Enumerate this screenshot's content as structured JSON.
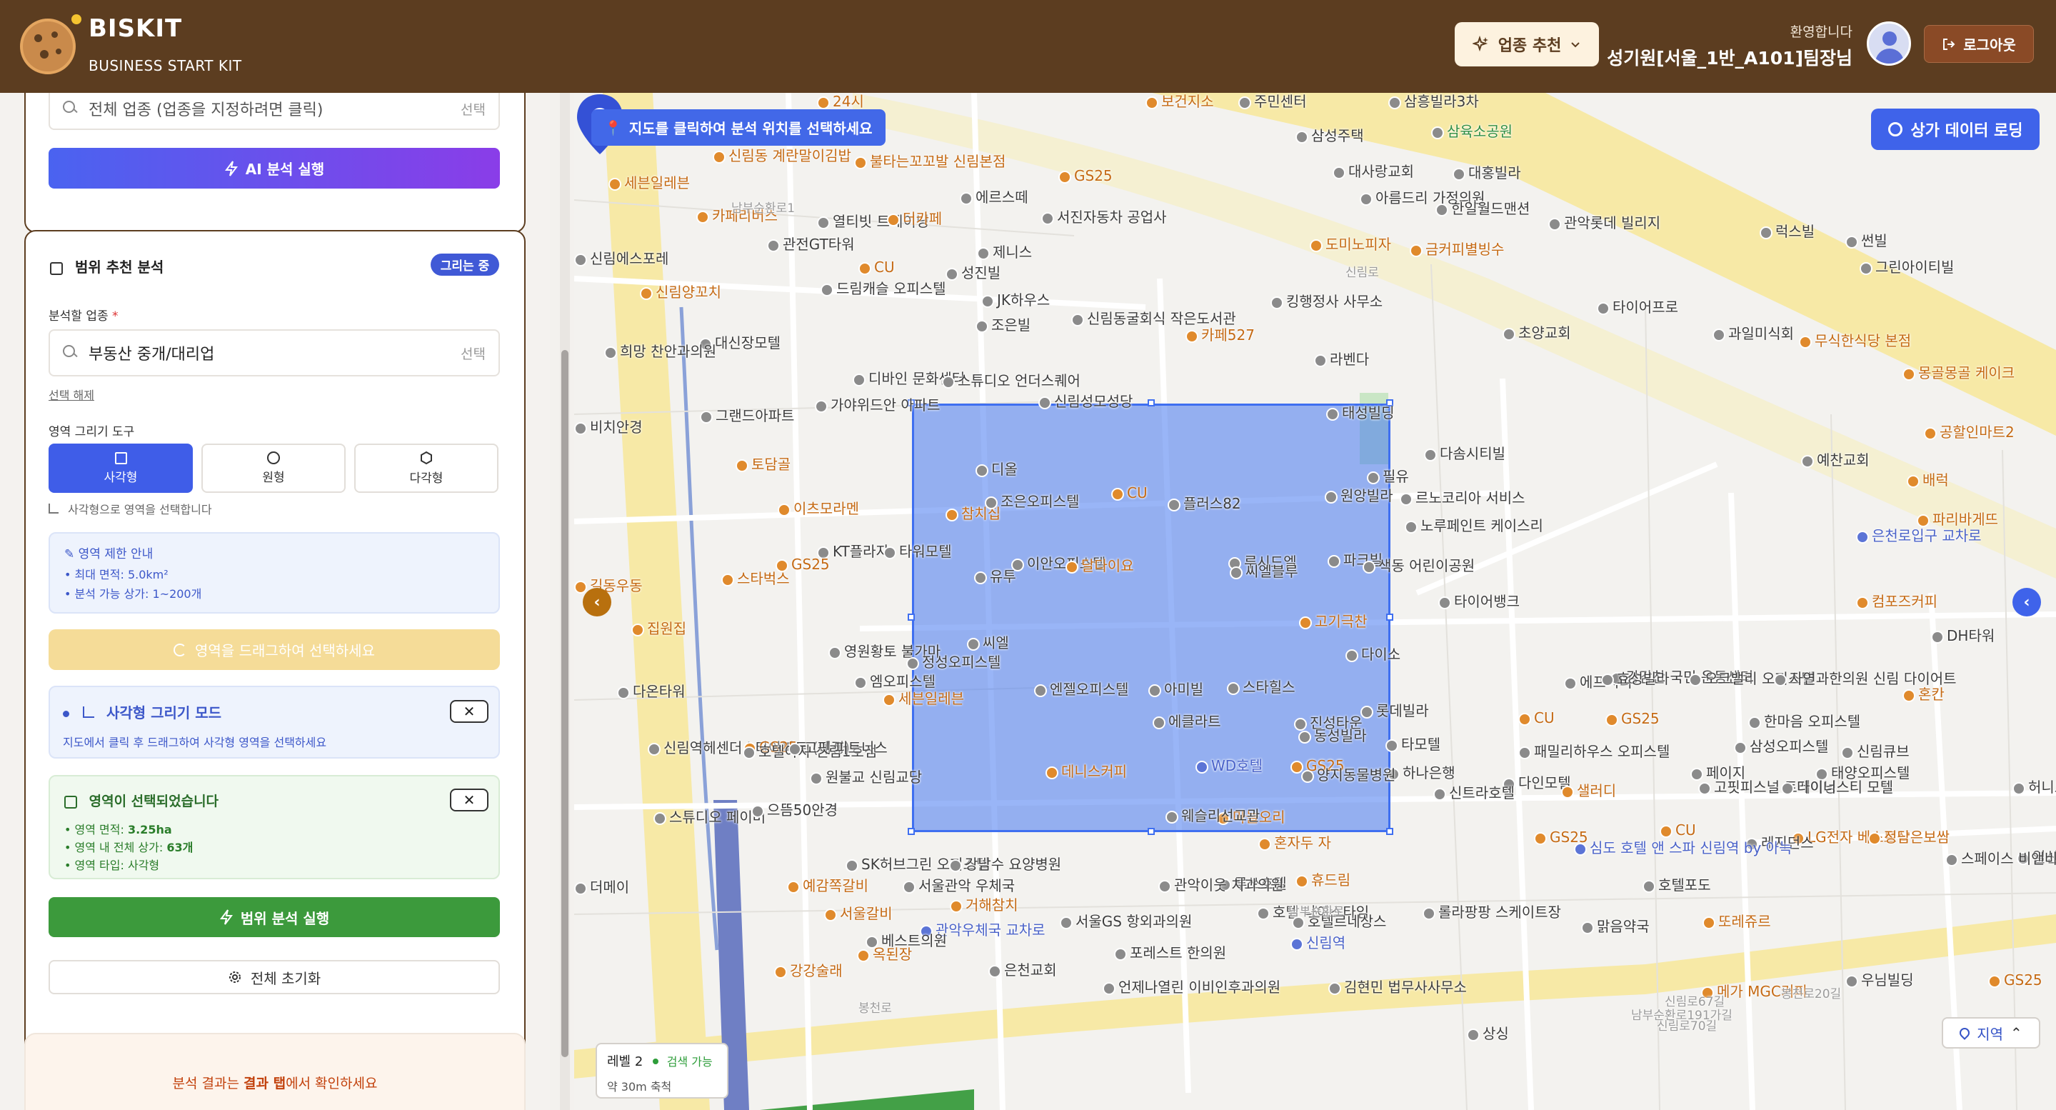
{
  "header": {
    "brand": "BISKIT",
    "subtitle": "BUSINESS START KIT",
    "business_recommend_label": "업종 추천",
    "welcome": "환영합니다",
    "username": "성기원[서울_1반_A101]팀장님",
    "logout_label": "로그아웃"
  },
  "sidebar": {
    "top_card": {
      "search_placeholder": "전체 업종 (업종을 지정하려면 클릭)",
      "select_label": "선택",
      "ai_button": "AI 분석 실행"
    },
    "range_card": {
      "title": "범위 추천 분석",
      "badge": "그리는 중",
      "business_label": "분석할 업종",
      "required_mark": "*",
      "business_value": "부동산 중개/대리업",
      "select_label": "선택",
      "deselect": "선택 해제",
      "draw_tool_label": "영역 그리기 도구",
      "tools": [
        {
          "label": "사각형",
          "icon": "square-icon",
          "active": true
        },
        {
          "label": "원형",
          "icon": "circle-icon",
          "active": false
        },
        {
          "label": "다각형",
          "icon": "hexagon-icon",
          "active": false
        }
      ],
      "tool_hint": "사각형으로 영역을 선택합니다",
      "limit_title": "영역 제한 안내",
      "limit_items": [
        "• 최대 면적: 5.0km²",
        "• 분석 가능 상가: 1~200개"
      ],
      "drag_notice": "영역을 드래그하여 선택하세요",
      "mode_title": "사각형 그리기 모드",
      "mode_desc": "지도에서 클릭 후 드래그하여 사각형 영역을 선택하세요",
      "selected_title": "영역이 선택되었습니다",
      "selected_items": [
        {
          "label": "• 영역 면적: ",
          "value": "3.25ha"
        },
        {
          "label": "• 영역 내 전체 상가: ",
          "value": "63개"
        },
        {
          "label": "• 영역 타입: ",
          "value": "사각형"
        }
      ],
      "range_button": "범위 분석 실행",
      "reset_button": "전체 초기화"
    },
    "result_note": {
      "prefix": "분석 결과는 ",
      "bold": "결과 탭",
      "suffix": "에서 확인하세요"
    }
  },
  "map": {
    "hint": "지도를 클릭하여 분석 위치를 선택하세요",
    "store_button": "상가 데이터 로딩",
    "level_title": "레벨 2",
    "level_status": "검색 가능",
    "level_scale": "약 30m 축척",
    "region_button": "지역",
    "colors": {
      "selection": "#4678f0",
      "road_main": "#f7e9a6",
      "park": "#c9e6c5"
    },
    "labels": [
      {
        "text": "24시",
        "c": "orange"
      },
      {
        "text": "보건지소",
        "c": "orange"
      },
      {
        "text": "주민센터",
        "c": ""
      },
      {
        "text": "삼흥빌라3차",
        "c": ""
      },
      {
        "text": "삼육소공원",
        "c": "green"
      },
      {
        "text": "신림동 계란말이김밥",
        "c": "orange"
      },
      {
        "text": "불타는꼬꼬발 신림본점",
        "c": "orange"
      },
      {
        "text": "세븐일레븐",
        "c": "orange"
      },
      {
        "text": "에르스떼",
        "c": ""
      },
      {
        "text": "GS25",
        "c": "orange"
      },
      {
        "text": "대사랑교회",
        "c": ""
      },
      {
        "text": "삼성주택",
        "c": ""
      },
      {
        "text": "대홍빌라",
        "c": ""
      },
      {
        "text": "카페리버스",
        "c": "orange"
      },
      {
        "text": "열티빗 트레이닝",
        "c": ""
      },
      {
        "text": "더카페",
        "c": "orange"
      },
      {
        "text": "아름드리 가정의원",
        "c": ""
      },
      {
        "text": "한일월드맨션",
        "c": ""
      },
      {
        "text": "관악롯데 빌리지",
        "c": ""
      },
      {
        "text": "럭스빌",
        "c": ""
      },
      {
        "text": "썬빌",
        "c": ""
      },
      {
        "text": "관전GT타워",
        "c": ""
      },
      {
        "text": "CU",
        "c": "orange"
      },
      {
        "text": "제니스",
        "c": ""
      },
      {
        "text": "서진자동차 공업사",
        "c": ""
      },
      {
        "text": "도미노피자",
        "c": "orange"
      },
      {
        "text": "금커피별빙수",
        "c": "orange"
      },
      {
        "text": "그린아이티빌",
        "c": ""
      },
      {
        "text": "신림에스포레",
        "c": ""
      },
      {
        "text": "성진빌",
        "c": ""
      },
      {
        "text": "드림캐슬 오피스텔",
        "c": ""
      },
      {
        "text": "JK하우스",
        "c": ""
      },
      {
        "text": "신림양꼬치",
        "c": "orange"
      },
      {
        "text": "조은빌",
        "c": ""
      },
      {
        "text": "신림동굴회식 작은도서관",
        "c": ""
      },
      {
        "text": "킹행정사 사무소",
        "c": ""
      },
      {
        "text": "카페527",
        "c": "orange"
      },
      {
        "text": "타이어프로",
        "c": ""
      },
      {
        "text": "대신장모텔",
        "c": ""
      },
      {
        "text": "희망 찬안과의원",
        "c": ""
      },
      {
        "text": "라벤다",
        "c": ""
      },
      {
        "text": "초양교회",
        "c": ""
      },
      {
        "text": "과일미식회",
        "c": ""
      },
      {
        "text": "무식한식당 본점",
        "c": "orange"
      },
      {
        "text": "디바인 문화센터",
        "c": ""
      },
      {
        "text": "스튜디오 언더스퀘어",
        "c": ""
      },
      {
        "text": "몽골몽골 케이크",
        "c": "orange"
      },
      {
        "text": "공할인마트2",
        "c": "orange"
      },
      {
        "text": "그랜드아파트",
        "c": ""
      },
      {
        "text": "신림성모성당",
        "c": ""
      },
      {
        "text": "태성빌딩",
        "c": ""
      },
      {
        "text": "가야위드안 아파트",
        "c": ""
      },
      {
        "text": "토담골",
        "c": "orange"
      },
      {
        "text": "비치안경",
        "c": ""
      },
      {
        "text": "다솜시티빌",
        "c": ""
      },
      {
        "text": "필유",
        "c": ""
      },
      {
        "text": "예찬교회",
        "c": ""
      },
      {
        "text": "배럭",
        "c": "orange"
      },
      {
        "text": "이츠모라멘",
        "c": "orange"
      },
      {
        "text": "디올",
        "c": ""
      },
      {
        "text": "참치집",
        "c": "orange"
      },
      {
        "text": "조은오피스텔",
        "c": ""
      },
      {
        "text": "CU",
        "c": "orange"
      },
      {
        "text": "플러스82",
        "c": ""
      },
      {
        "text": "원앙빌라",
        "c": ""
      },
      {
        "text": "르노코리아 서비스",
        "c": ""
      },
      {
        "text": "파리바게뜨",
        "c": "orange"
      },
      {
        "text": "KT플라자",
        "c": ""
      },
      {
        "text": "노루페인트 케이스리",
        "c": ""
      },
      {
        "text": "은천로입구 교차로",
        "c": "blue"
      },
      {
        "text": "GS25",
        "c": "orange"
      },
      {
        "text": "이안오피스텔",
        "c": ""
      },
      {
        "text": "달다이요",
        "c": "orange"
      },
      {
        "text": "루시드엘",
        "c": ""
      },
      {
        "text": "파크빌",
        "c": ""
      },
      {
        "text": "타워모텔",
        "c": ""
      },
      {
        "text": "유투",
        "c": ""
      },
      {
        "text": "씨엘블루",
        "c": ""
      },
      {
        "text": "색동 어린이공원",
        "c": ""
      },
      {
        "text": "타이어뱅크",
        "c": ""
      },
      {
        "text": "컴포즈커피",
        "c": "orange"
      },
      {
        "text": "길동우동",
        "c": "orange"
      },
      {
        "text": "스타벅스",
        "c": "orange"
      },
      {
        "text": "집원집",
        "c": "orange"
      },
      {
        "text": "영원황토 불가마",
        "c": ""
      },
      {
        "text": "씨엘",
        "c": ""
      },
      {
        "text": "고기극찬",
        "c": "orange"
      },
      {
        "text": "DH타워",
        "c": ""
      },
      {
        "text": "정성오피스텔",
        "c": ""
      },
      {
        "text": "다이소",
        "c": ""
      },
      {
        "text": "엠오피스텔",
        "c": ""
      },
      {
        "text": "엔젤오피스텔",
        "c": ""
      },
      {
        "text": "아미빌",
        "c": ""
      },
      {
        "text": "에프씨티",
        "c": ""
      },
      {
        "text": "강감찬 국민 운동센터",
        "c": ""
      },
      {
        "text": "효성빌라",
        "c": ""
      },
      {
        "text": "오크밸리 오피스텔",
        "c": ""
      },
      {
        "text": "자연과한의원 신림 다이어트",
        "c": ""
      },
      {
        "text": "혼칸",
        "c": "orange"
      },
      {
        "text": "다온타워",
        "c": ""
      },
      {
        "text": "세븐일레븐",
        "c": "orange"
      },
      {
        "text": "스타힐스",
        "c": ""
      },
      {
        "text": "진성타운",
        "c": ""
      },
      {
        "text": "롯데빌라",
        "c": ""
      },
      {
        "text": "CU",
        "c": "orange"
      },
      {
        "text": "GS25",
        "c": "orange"
      },
      {
        "text": "한마음 오피스텔",
        "c": ""
      },
      {
        "text": "삼성오피스텔",
        "c": ""
      },
      {
        "text": "신림역헤센더스타아파트 (예정)",
        "c": ""
      },
      {
        "text": "에클라트",
        "c": ""
      },
      {
        "text": "동성빌라",
        "c": ""
      },
      {
        "text": "타모텔",
        "c": ""
      },
      {
        "text": "패밀리하우스 오피스텔",
        "c": ""
      },
      {
        "text": "신림큐브",
        "c": ""
      },
      {
        "text": "GS25",
        "c": "orange"
      },
      {
        "text": "호텔야자 신림1호점",
        "c": ""
      },
      {
        "text": "고핏 피트니스",
        "c": ""
      },
      {
        "text": "GS25",
        "c": "orange"
      },
      {
        "text": "WD호텔",
        "c": "blue"
      },
      {
        "text": "하나은행",
        "c": ""
      },
      {
        "text": "페이지",
        "c": ""
      },
      {
        "text": "태양오피스텔",
        "c": ""
      },
      {
        "text": "원불교 신림교당",
        "c": ""
      },
      {
        "text": "데니스커피",
        "c": "orange"
      },
      {
        "text": "양지동물병원",
        "c": ""
      },
      {
        "text": "다인모텔",
        "c": ""
      },
      {
        "text": "고핏피스널 트레이닝",
        "c": ""
      },
      {
        "text": "스튜디오 페이버",
        "c": ""
      },
      {
        "text": "으뜸50안경",
        "c": ""
      },
      {
        "text": "마늘오리",
        "c": "orange"
      },
      {
        "text": "신트라호텔",
        "c": ""
      },
      {
        "text": "샐러디",
        "c": "orange"
      },
      {
        "text": "다이너스티 모텔",
        "c": ""
      },
      {
        "text": "허니모텔",
        "c": ""
      },
      {
        "text": "웨슬리선교관",
        "c": ""
      },
      {
        "text": "GS25",
        "c": "orange"
      },
      {
        "text": "LG전자 베스트샵",
        "c": "orange"
      },
      {
        "text": "정담은보쌈",
        "c": "orange"
      },
      {
        "text": "SK허브그린 오피스텔",
        "c": ""
      },
      {
        "text": "강남수 요양병원",
        "c": ""
      },
      {
        "text": "루쏘호텔",
        "c": ""
      },
      {
        "text": "휴드림",
        "c": "orange"
      },
      {
        "text": "CU",
        "c": "orange"
      },
      {
        "text": "일신산업",
        "c": ""
      },
      {
        "text": "예감쪽갈비",
        "c": "orange"
      },
      {
        "text": "서울관악 우체국",
        "c": ""
      },
      {
        "text": "혼자두 자",
        "c": "orange"
      },
      {
        "text": "레지던스",
        "c": ""
      },
      {
        "text": "심도 호텔 앤 스파 신림역 by 아늑",
        "c": "blue"
      },
      {
        "text": "스페이스 비앤비",
        "c": ""
      },
      {
        "text": "더메이",
        "c": ""
      },
      {
        "text": "거해참치",
        "c": "orange"
      },
      {
        "text": "관악이웃 치과의원",
        "c": ""
      },
      {
        "text": "호텔 나이스타임",
        "c": ""
      },
      {
        "text": "호텔르네상스",
        "c": ""
      },
      {
        "text": "호텔포도",
        "c": ""
      },
      {
        "text": "서울GS 항외과의원",
        "c": ""
      },
      {
        "text": "서울갈비",
        "c": "orange"
      },
      {
        "text": "관악우체국 교차로",
        "c": "blue"
      },
      {
        "text": "롤라팡팡 스케이트장",
        "c": ""
      },
      {
        "text": "맑음약국",
        "c": ""
      },
      {
        "text": "또레쥬르",
        "c": "orange"
      },
      {
        "text": "베스트의원",
        "c": ""
      },
      {
        "text": "신림역",
        "c": "blue"
      },
      {
        "text": "옥된장",
        "c": "orange"
      },
      {
        "text": "포레스트 한의원",
        "c": ""
      },
      {
        "text": "언제나열린 이비인후과의원",
        "c": ""
      },
      {
        "text": "김현민 법무사사무소",
        "c": ""
      },
      {
        "text": "은천교회",
        "c": ""
      },
      {
        "text": "강강술래",
        "c": "orange"
      },
      {
        "text": "메가 MGC커피",
        "c": "orange"
      },
      {
        "text": "우님빌딩",
        "c": ""
      },
      {
        "text": "GS25",
        "c": "orange"
      },
      {
        "text": "봉천로",
        "c": "road"
      },
      {
        "text": "신림로70길",
        "c": "road"
      },
      {
        "text": "신림로67길",
        "c": "road"
      },
      {
        "text": "봉천로20길",
        "c": "road"
      },
      {
        "text": "남부순환로",
        "c": "road"
      },
      {
        "text": "남부순환로191가길",
        "c": "road"
      },
      {
        "text": "신림로",
        "c": "road"
      },
      {
        "text": "남부순환로1",
        "c": "road"
      },
      {
        "text": "상싱",
        "c": ""
      }
    ]
  }
}
